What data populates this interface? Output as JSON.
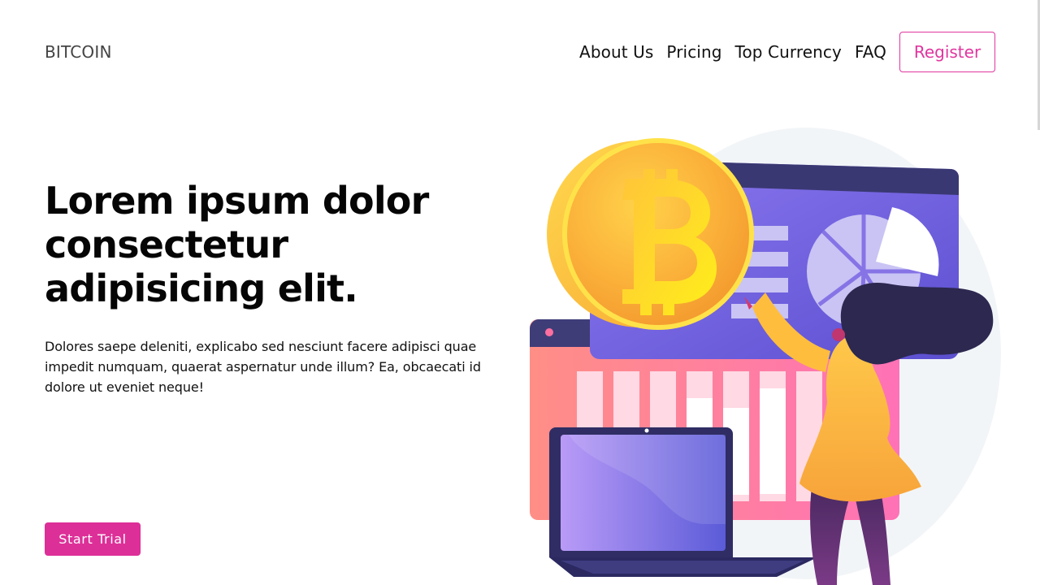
{
  "header": {
    "brand": "BITCOIN",
    "nav": [
      "About Us",
      "Pricing",
      "Top Currency",
      "FAQ"
    ],
    "register_label": "Register"
  },
  "hero": {
    "title": "Lorem ipsum dolor consectetur adipisicing elit.",
    "text": "Dolores saepe deleniti, explicabo sed nesciunt facere adipisci quae impedit numquam, quaerat aspernatur unde illum? Ea, obcaecati id dolore ut eveniet neque!",
    "cta_label": "Start Trial"
  },
  "illustration": {
    "icon": "bitcoin-coin-icon",
    "subject": "woman-presenting-crypto-chart",
    "colors": {
      "accent": "#dd2f98",
      "coin": "#f9b233",
      "panel": "#6f63d9",
      "board": "#f77d9c"
    }
  }
}
